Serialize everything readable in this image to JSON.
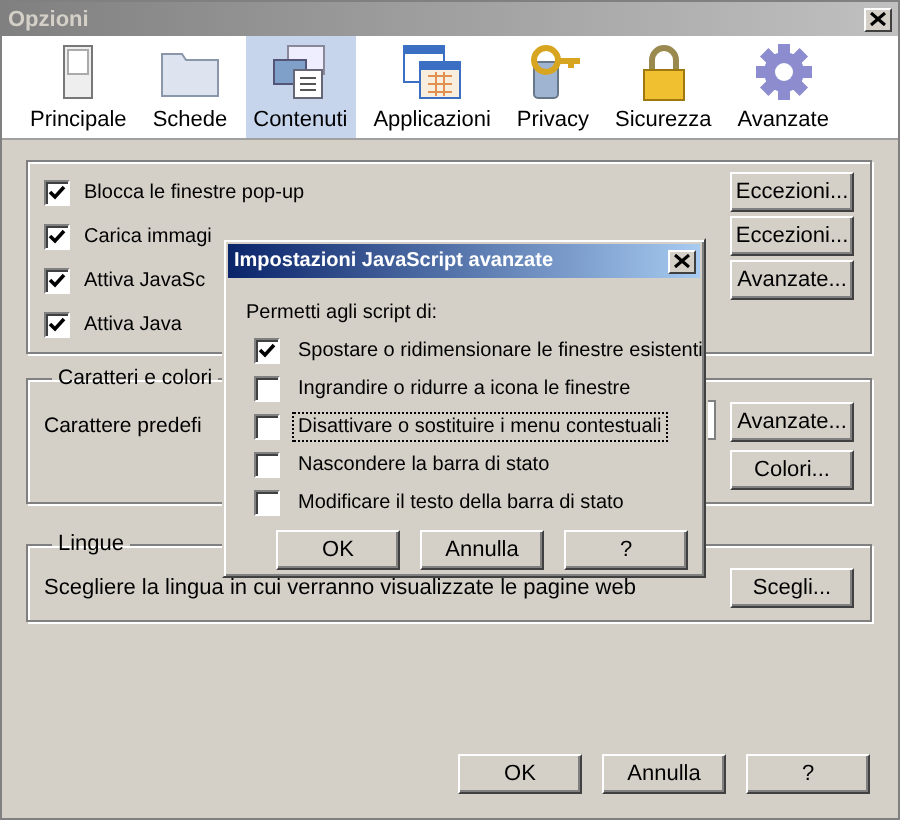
{
  "window": {
    "title": "Opzioni"
  },
  "tabs": [
    {
      "label": "Principale",
      "selected": false
    },
    {
      "label": "Schede",
      "selected": false
    },
    {
      "label": "Contenuti",
      "selected": true
    },
    {
      "label": "Applicazioni",
      "selected": false
    },
    {
      "label": "Privacy",
      "selected": false
    },
    {
      "label": "Sicurezza",
      "selected": false
    },
    {
      "label": "Avanzate",
      "selected": false
    }
  ],
  "content_group": {
    "rows": [
      {
        "label": "Blocca le finestre pop-up",
        "checked": true,
        "button": "Eccezioni..."
      },
      {
        "label": "Carica immagi",
        "checked": true,
        "button": "Eccezioni..."
      },
      {
        "label": "Attiva JavaSc",
        "checked": true,
        "button": "Avanzate..."
      },
      {
        "label": "Attiva Java",
        "checked": true
      }
    ]
  },
  "fonts_group": {
    "legend": "Caratteri e colori",
    "label": "Carattere predefi",
    "buttons": [
      "Avanzate...",
      "Colori..."
    ]
  },
  "languages_group": {
    "legend": "Lingue",
    "text": "Scegliere la lingua in cui verranno visualizzate le pagine web",
    "button": "Scegli..."
  },
  "buttons": [
    "OK",
    "Annulla",
    "?"
  ],
  "dialog": {
    "title": "Impostazioni JavaScript avanzate",
    "prompt": "Permetti agli script di:",
    "options": [
      {
        "label": "Spostare o ridimensionare le finestre esistenti",
        "checked": true,
        "focused": false
      },
      {
        "label": "Ingrandire o ridurre a icona le finestre",
        "checked": false,
        "focused": false
      },
      {
        "label": "Disattivare o sostituire i menu contestuali",
        "checked": false,
        "focused": true
      },
      {
        "label": "Nascondere la barra di stato",
        "checked": false,
        "focused": false
      },
      {
        "label": "Modificare il testo della barra di stato",
        "checked": false,
        "focused": false
      }
    ],
    "buttons": [
      "OK",
      "Annulla",
      "?"
    ]
  }
}
